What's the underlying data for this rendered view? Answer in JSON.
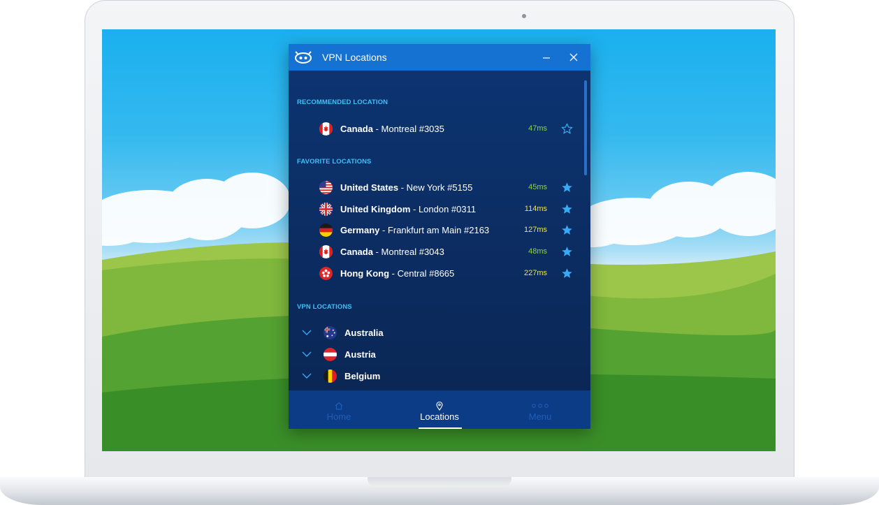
{
  "window": {
    "title": "VPN Locations",
    "minimize_icon": "minimize-icon",
    "close_icon": "close-icon"
  },
  "colors": {
    "accent": "#1672d2",
    "header_text": "#3ec0f7",
    "latency_good": "#8fd14f",
    "latency_mid": "#f2e53c",
    "star": "#3aa9f4"
  },
  "recommended": {
    "header": "RECOMMENDED LOCATION",
    "items": [
      {
        "country": "Canada",
        "server": " - Montreal #3035",
        "latency": "47ms",
        "favorite": false,
        "flag": "canada-flag"
      }
    ]
  },
  "favorites": {
    "header": "FAVORITE LOCATIONS",
    "items": [
      {
        "country": "United States",
        "server": " - New York #5155",
        "latency": "45ms",
        "favorite": true,
        "flag": "us-flag"
      },
      {
        "country": "United Kingdom",
        "server": " - London #0311",
        "latency": "114ms",
        "favorite": true,
        "flag": "uk-flag"
      },
      {
        "country": "Germany",
        "server": " - Frankfurt am Main #2163",
        "latency": "127ms",
        "favorite": true,
        "flag": "germany-flag"
      },
      {
        "country": "Canada",
        "server": " - Montreal #3043",
        "latency": "48ms",
        "favorite": true,
        "flag": "canada-flag"
      },
      {
        "country": "Hong Kong",
        "server": " - Central #8665",
        "latency": "227ms",
        "favorite": true,
        "flag": "hongkong-flag"
      }
    ]
  },
  "vpn_locations": {
    "header": "VPN LOCATIONS",
    "items": [
      {
        "name": "Australia",
        "flag": "australia-flag"
      },
      {
        "name": "Austria",
        "flag": "austria-flag"
      },
      {
        "name": "Belgium",
        "flag": "belgium-flag"
      }
    ]
  },
  "nav": {
    "items": [
      {
        "label": "Home",
        "icon": "home-icon",
        "active": false
      },
      {
        "label": "Locations",
        "icon": "location-pin-icon",
        "active": true
      },
      {
        "label": "Menu",
        "icon": "more-dots-icon",
        "active": false
      }
    ]
  }
}
